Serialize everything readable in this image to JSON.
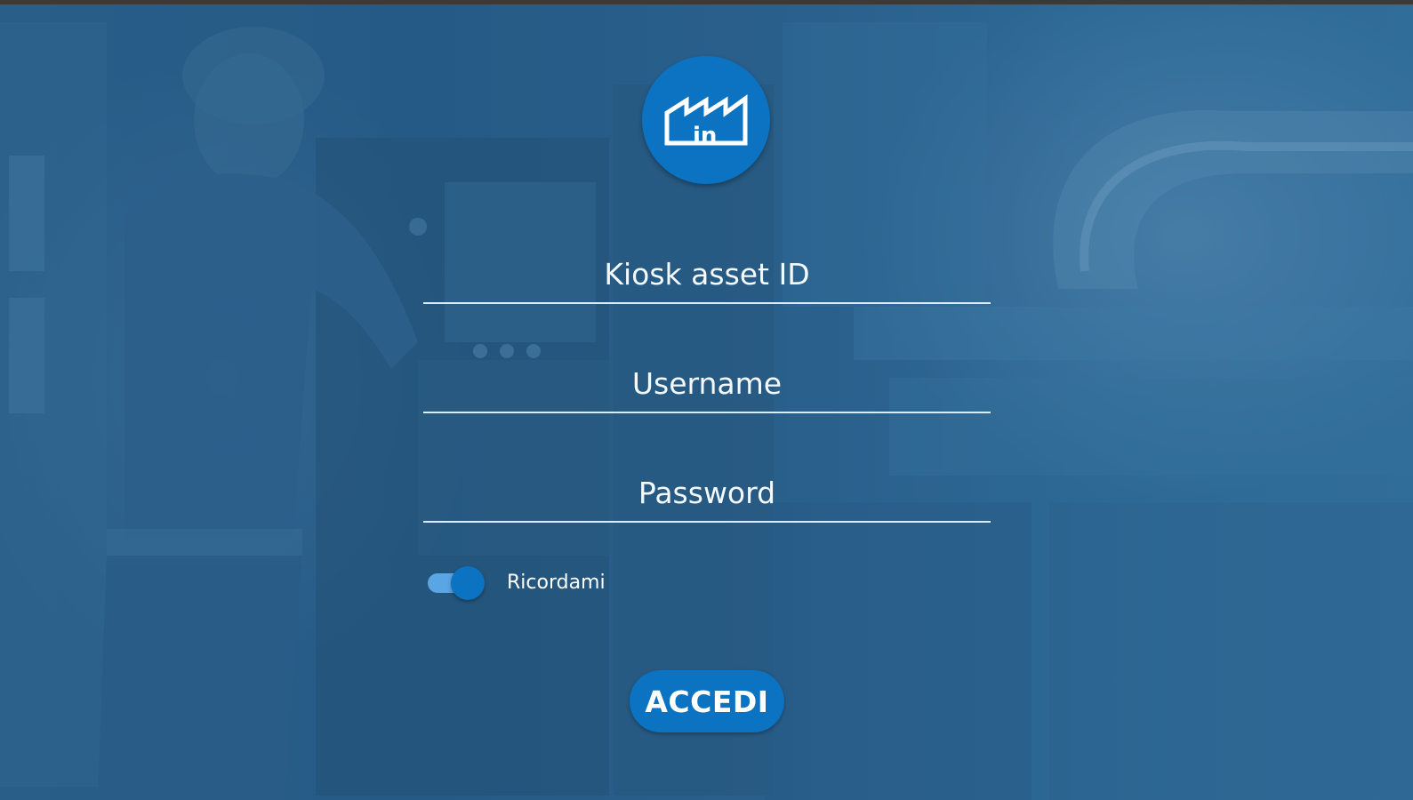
{
  "brand": {
    "logo_icon": "factory-in-icon",
    "logo_text": "in",
    "accent_color": "#0c72c2"
  },
  "form": {
    "kiosk_asset_id": {
      "placeholder": "Kiosk asset ID",
      "value": ""
    },
    "username": {
      "placeholder": "Username",
      "value": ""
    },
    "password": {
      "placeholder": "Password",
      "value": ""
    },
    "remember_me": {
      "label": "Ricordami",
      "checked": true
    },
    "submit_label": "ACCEDI"
  }
}
